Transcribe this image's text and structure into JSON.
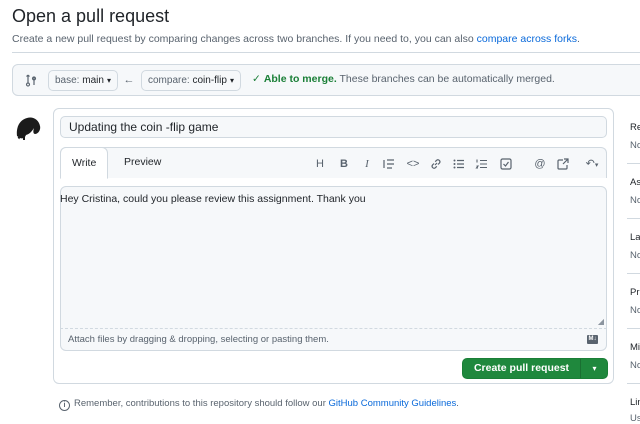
{
  "header": {
    "title": "Open a pull request",
    "subtitle_prefix": "Create a new pull request by comparing changes across two branches. If you need to, you can also ",
    "subtitle_link": "compare across forks",
    "subtitle_suffix": "."
  },
  "compare": {
    "base_label": "base:",
    "base_value": "main",
    "compare_label": "compare:",
    "compare_value": "coin-flip",
    "merge_ok": "Able to merge.",
    "merge_detail": " These branches can be automatically merged."
  },
  "form": {
    "title_value": "Updating the coin -flip game",
    "tabs": {
      "write": "Write",
      "preview": "Preview"
    },
    "body_text": "Hey Cristina, could you please review this assignment. Thank you",
    "attach_text": "Attach files by dragging & dropping, selecting or pasting them.",
    "create_button": "Create pull request"
  },
  "guidelines": {
    "prefix": "Remember, contributions to this repository should follow our ",
    "link": "GitHub Community Guidelines",
    "suffix": "."
  },
  "sidebar": {
    "items": [
      {
        "head": "Re",
        "value": "No"
      },
      {
        "head": "As",
        "value": "No"
      },
      {
        "head": "La",
        "value": "No"
      },
      {
        "head": "Pr",
        "value": "No"
      },
      {
        "head": "Mi",
        "value": "No"
      },
      {
        "head": "Lin",
        "value": "Us"
      }
    ]
  },
  "colors": {
    "accent_link": "#0969da",
    "success_green": "#1f883d",
    "merge_green": "#1a7f37"
  }
}
